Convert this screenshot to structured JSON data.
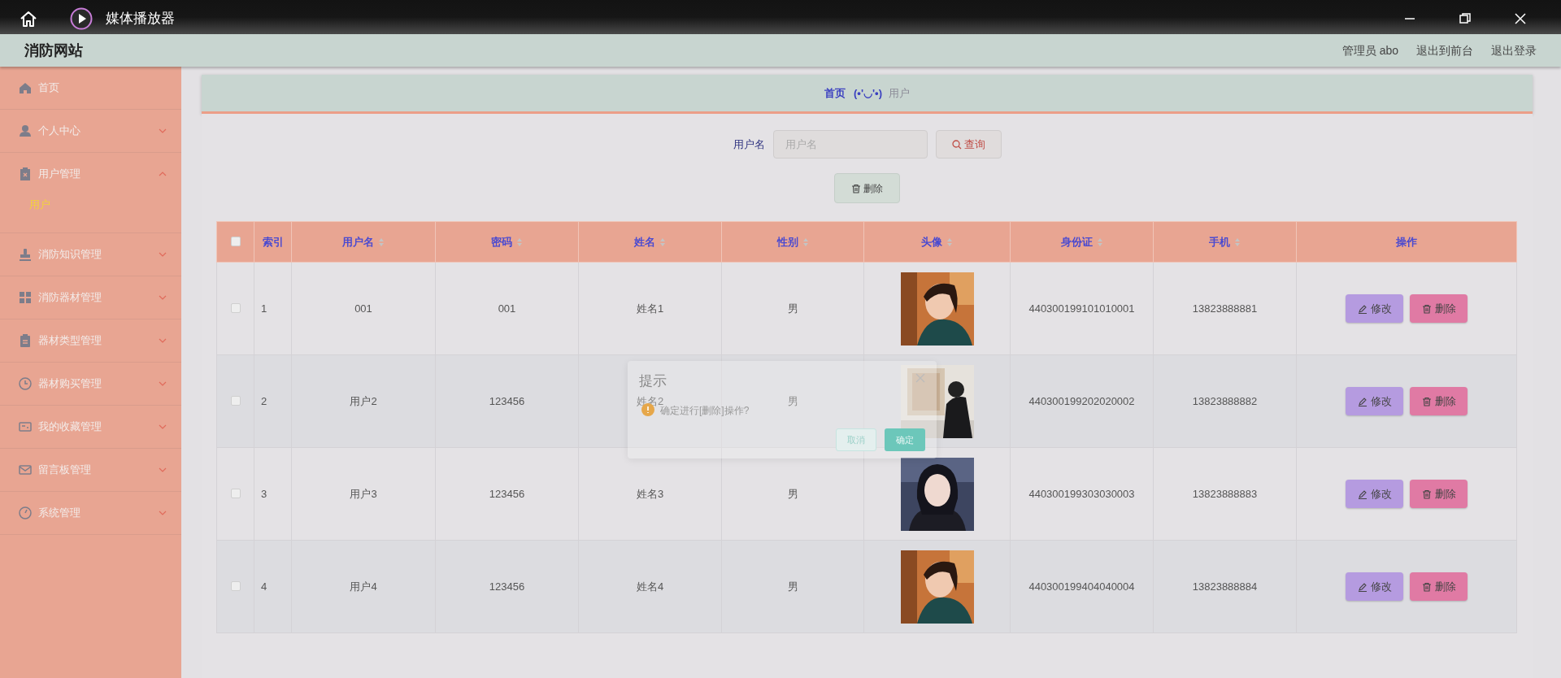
{
  "player_bar": {
    "title": "媒体播放器"
  },
  "header": {
    "site_title": "消防网站",
    "links": [
      "管理员 abo",
      "退出到前台",
      "退出登录"
    ]
  },
  "sidebar": {
    "items": [
      {
        "label": "首页",
        "kind": "link"
      },
      {
        "label": "个人中心",
        "kind": "menu",
        "expanded": false
      },
      {
        "label": "用户管理",
        "kind": "menu",
        "expanded": true,
        "children": [
          {
            "label": "用户",
            "selected": true
          }
        ]
      },
      {
        "label": "消防知识管理",
        "kind": "menu",
        "expanded": false
      },
      {
        "label": "消防器材管理",
        "kind": "menu",
        "expanded": false
      },
      {
        "label": "器材类型管理",
        "kind": "menu",
        "expanded": false
      },
      {
        "label": "器材购买管理",
        "kind": "menu",
        "expanded": false
      },
      {
        "label": "我的收藏管理",
        "kind": "menu",
        "expanded": false
      },
      {
        "label": "留言板管理",
        "kind": "menu",
        "expanded": false
      },
      {
        "label": "系统管理",
        "kind": "menu",
        "expanded": false
      }
    ]
  },
  "breadcrumb": {
    "home": "首页",
    "separator": "(•'◡'•)",
    "current": "用户"
  },
  "search": {
    "label": "用户名",
    "placeholder": "用户名",
    "button": "查询"
  },
  "bulk_delete": "删除",
  "table": {
    "header_checked": false,
    "columns": [
      {
        "label": "索引",
        "sortable": false
      },
      {
        "label": "用户名",
        "sortable": true
      },
      {
        "label": "密码",
        "sortable": true
      },
      {
        "label": "姓名",
        "sortable": true
      },
      {
        "label": "性别",
        "sortable": true
      },
      {
        "label": "头像",
        "sortable": true
      },
      {
        "label": "身份证",
        "sortable": true
      },
      {
        "label": "手机",
        "sortable": true
      },
      {
        "label": "操作",
        "sortable": false
      }
    ],
    "rows": [
      {
        "checked": false,
        "index": "1",
        "username": "001",
        "password": "001",
        "name": "姓名1",
        "gender": "男",
        "id_card": "440300199101010001",
        "phone": "13823888881",
        "actions": [
          "修改",
          "删除"
        ]
      },
      {
        "checked": false,
        "index": "2",
        "username": "用户2",
        "password": "123456",
        "name": "姓名2",
        "gender": "男",
        "id_card": "440300199202020002",
        "phone": "13823888882",
        "actions": [
          "修改",
          "删除"
        ]
      },
      {
        "checked": false,
        "index": "3",
        "username": "用户3",
        "password": "123456",
        "name": "姓名3",
        "gender": "男",
        "id_card": "440300199303030003",
        "phone": "13823888883",
        "actions": [
          "修改",
          "删除"
        ]
      },
      {
        "checked": false,
        "index": "4",
        "username": "用户4",
        "password": "123456",
        "name": "姓名4",
        "gender": "男",
        "id_card": "440300199404040004",
        "phone": "13823888884",
        "actions": [
          "修改",
          "删除"
        ]
      }
    ]
  },
  "dialog": {
    "title": "提示",
    "message": "确定进行[删除]操作?",
    "buttons": [
      {
        "label": "取消",
        "kind": "secondary"
      },
      {
        "label": "确定",
        "kind": "primary"
      }
    ]
  }
}
